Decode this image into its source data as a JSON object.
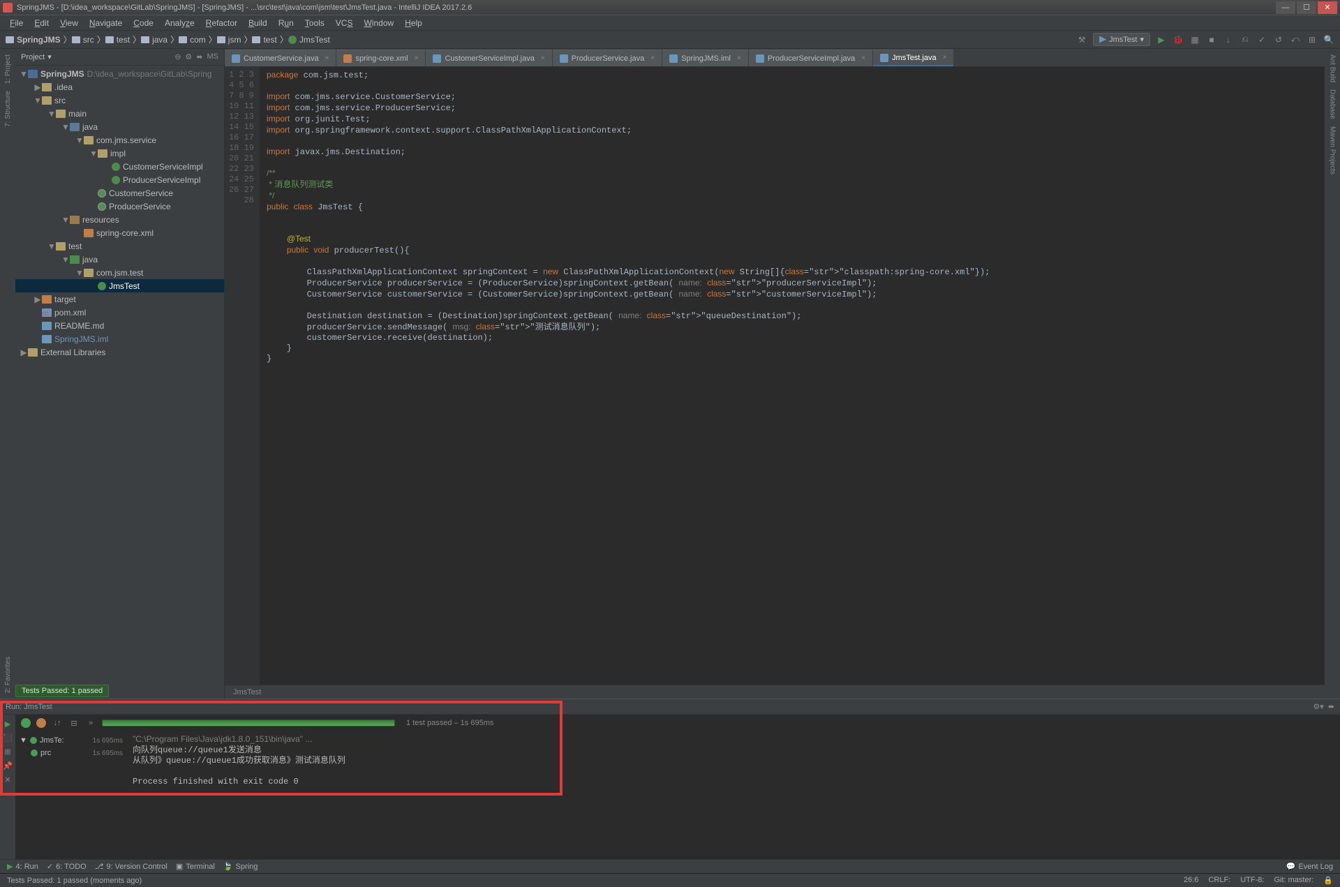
{
  "title": "SpringJMS - [D:\\idea_workspace\\GitLab\\SpringJMS] - [SpringJMS] - ...\\src\\test\\java\\com\\jsm\\test\\JmsTest.java - IntelliJ IDEA 2017.2.6",
  "menu": [
    "File",
    "Edit",
    "View",
    "Navigate",
    "Code",
    "Analyze",
    "Refactor",
    "Build",
    "Run",
    "Tools",
    "VCS",
    "Window",
    "Help"
  ],
  "breadcrumbs": [
    "SpringJMS",
    "src",
    "test",
    "java",
    "com",
    "jsm",
    "test",
    "JmsTest"
  ],
  "run_config": "JmsTest",
  "project_header": "Project",
  "tree": {
    "root": "SpringJMS",
    "root_path": "D:\\idea_workspace\\GitLab\\Spring",
    "idea": ".idea",
    "src": "src",
    "main": "main",
    "java1": "java",
    "pkg_service": "com.jms.service",
    "impl": "impl",
    "csi": "CustomerServiceImpl",
    "psi": "ProducerServiceImpl",
    "cs": "CustomerService",
    "ps": "ProducerService",
    "resources": "resources",
    "springxml": "spring-core.xml",
    "test": "test",
    "java2": "java",
    "pkg_test": "com.jsm.test",
    "jmstest": "JmsTest",
    "target": "target",
    "pom": "pom.xml",
    "readme": "README.md",
    "iml": "SpringJMS.iml",
    "ext": "External Libraries"
  },
  "tabs": [
    {
      "label": "CustomerService.java",
      "icon": "java"
    },
    {
      "label": "spring-core.xml",
      "icon": "xml"
    },
    {
      "label": "CustomerServiceImpl.java",
      "icon": "java"
    },
    {
      "label": "ProducerService.java",
      "icon": "java"
    },
    {
      "label": "SpringJMS.iml",
      "icon": "iml"
    },
    {
      "label": "ProducerServiceImpl.java",
      "icon": "java"
    },
    {
      "label": "JmsTest.java",
      "icon": "java",
      "active": true
    }
  ],
  "code_lines": [
    "package com.jsm.test;",
    "",
    "import com.jms.service.CustomerService;",
    "import com.jms.service.ProducerService;",
    "import org.junit.Test;",
    "import org.springframework.context.support.ClassPathXmlApplicationContext;",
    "",
    "import javax.jms.Destination;",
    "",
    "/**",
    " * 消息队列测试类",
    " */",
    "public class JmsTest {",
    "",
    "",
    "    @Test",
    "    public void producerTest(){",
    "",
    "        ClassPathXmlApplicationContext springContext = new ClassPathXmlApplicationContext(new String[]{\"classpath:spring-core.xml\"});",
    "        ProducerService producerService = (ProducerService)springContext.getBean( name: \"producerServiceImpl\");",
    "        CustomerService customerService = (CustomerService)springContext.getBean( name: \"customerServiceImpl\");",
    "",
    "        Destination destination = (Destination)springContext.getBean( name: \"queueDestination\");",
    "        producerService.sendMessage( msg: \"测试消息队列\");",
    "        customerService.receive(destination);",
    "    }",
    "}",
    ""
  ],
  "editor_breadcrumb": "JmsTest",
  "run": {
    "header": "Run:   JmsTest",
    "status": "1 test passed",
    "elapsed": "1s 695ms",
    "tree_root": "JmsTe:",
    "tree_root_time": "1s 695ms",
    "tree_child": "prc",
    "tree_child_time": "1s 695ms",
    "console": [
      "\"C:\\Program Files\\Java\\jdk1.8.0_151\\bin\\java\" ...",
      "向队列queue://queue1发送消息",
      "从队列》queue://queue1成功获取消息》测试消息队列",
      "",
      "Process finished with exit code 0"
    ]
  },
  "status_pill": "Tests Passed: 1 passed",
  "bottom_tools": [
    "4: Run",
    "6: TODO",
    "9: Version Control",
    "Terminal",
    "Spring"
  ],
  "event_log": "Event Log",
  "status_left": "Tests Passed: 1 passed (moments ago)",
  "status_right": [
    "26:6",
    "CRLF:",
    "UTF-8:",
    "Git: master:"
  ]
}
